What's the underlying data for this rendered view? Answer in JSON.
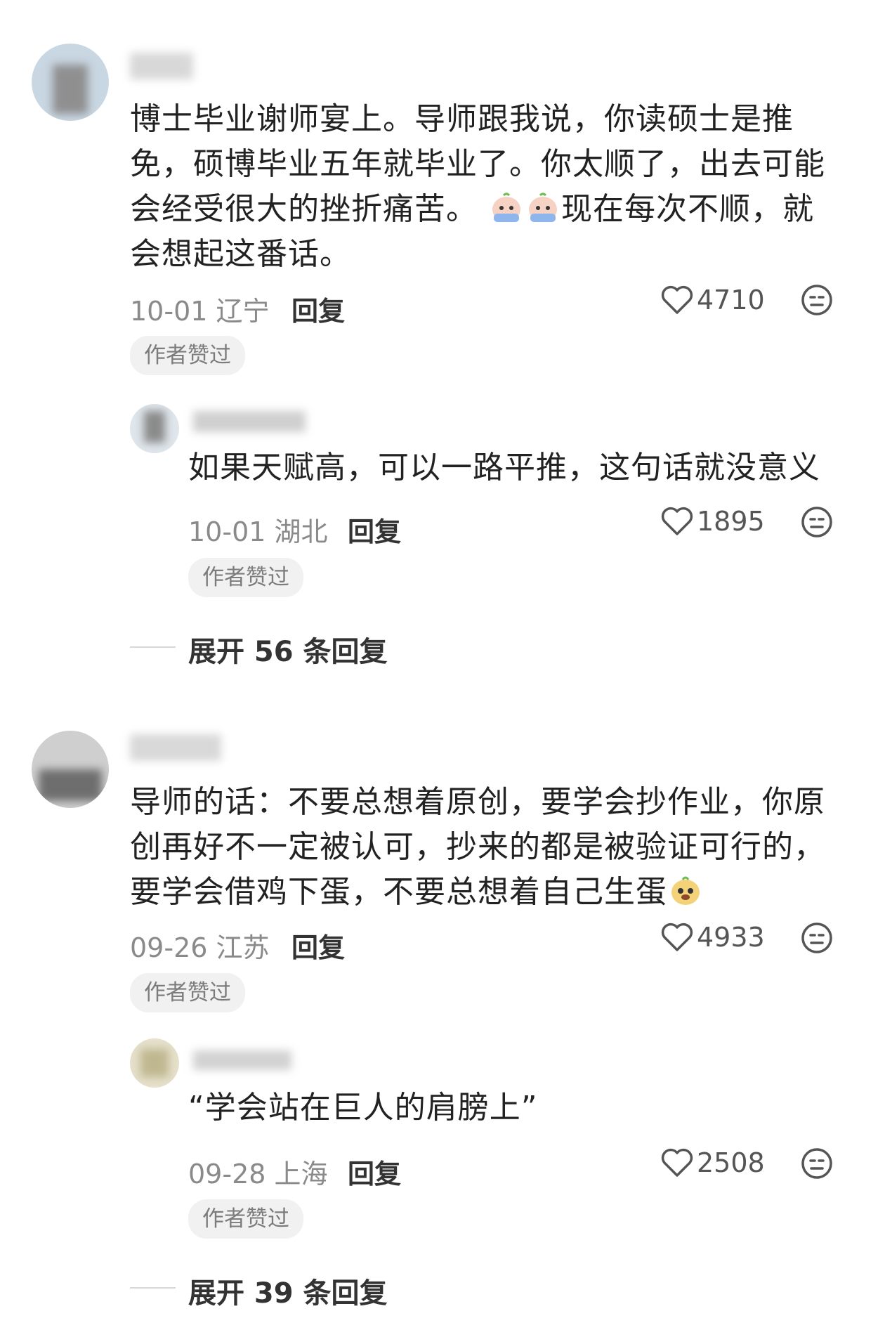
{
  "comments": [
    {
      "text_parts": [
        "博士毕业谢师宴上。导师跟我说，你读硕士是推",
        "免，硕博毕业五年就毕业了。你太顺了，出去可能",
        "会经受很大的挫折痛苦。",
        "现在每次不顺，就",
        "会想起这番话。"
      ],
      "date_location": "10-01 辽宁",
      "reply_label": "回复",
      "likes": "4710",
      "badge": "作者赞过",
      "reply": {
        "text": "如果天赋高，可以一路平推，这句话就没意义",
        "date_location": "10-01 湖北",
        "reply_label": "回复",
        "likes": "1895",
        "badge": "作者赞过"
      },
      "expand": "展开 56 条回复"
    },
    {
      "text_lines": [
        "导师的话：不要总想着原创，要学会抄作业，你原",
        "创再好不一定被认可，抄来的都是被验证可行的，",
        "要学会借鸡下蛋，不要总想着自己生蛋"
      ],
      "date_location": "09-26 江苏",
      "reply_label": "回复",
      "likes": "4933",
      "badge": "作者赞过",
      "reply": {
        "text": "“学会站在巨人的肩膀上”",
        "date_location": "09-28 上海",
        "reply_label": "回复",
        "likes": "2508",
        "badge": "作者赞过"
      },
      "expand": "展开 39 条回复"
    }
  ],
  "icons": {
    "like": "heart-outline-icon",
    "emoji_react": "smiley-face-icon",
    "inline_emoji_1": "crying-face-emoji",
    "inline_emoji_2": "sneaky-face-emoji"
  },
  "colors": {
    "text": "#222222",
    "meta": "#8a8a8a",
    "badge_bg": "#f1f1f1"
  }
}
